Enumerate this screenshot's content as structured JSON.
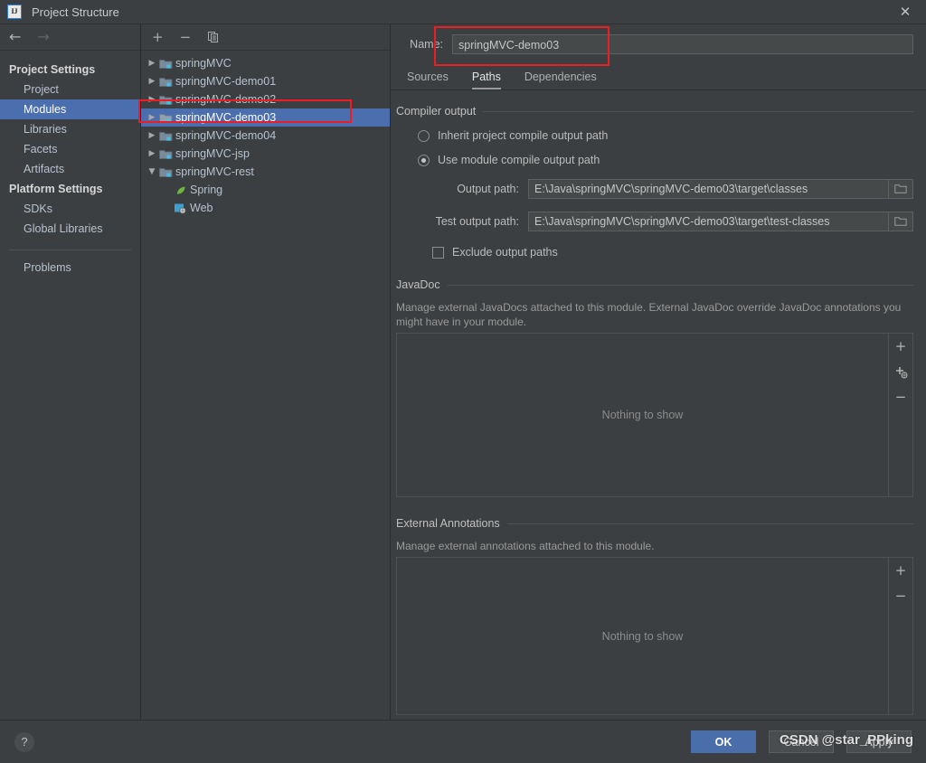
{
  "window": {
    "title": "Project Structure",
    "logo_text": "IJ",
    "close_icon": "✕"
  },
  "nav": {
    "back_icon": "←",
    "forward_icon": "→"
  },
  "sidebar": {
    "groups": [
      {
        "label": "Project Settings",
        "items": [
          {
            "label": "Project",
            "selected": false
          },
          {
            "label": "Modules",
            "selected": true
          },
          {
            "label": "Libraries",
            "selected": false
          },
          {
            "label": "Facets",
            "selected": false
          },
          {
            "label": "Artifacts",
            "selected": false
          }
        ]
      },
      {
        "label": "Platform Settings",
        "items": [
          {
            "label": "SDKs",
            "selected": false
          },
          {
            "label": "Global Libraries",
            "selected": false
          }
        ]
      }
    ],
    "problems_label": "Problems"
  },
  "tree": {
    "toolbar": {
      "add_icon": "+",
      "remove_icon": "−",
      "copy_icon": "copy-icon"
    },
    "expand_collapsed_icon": "▶",
    "expand_expanded_icon": "▼",
    "rows": [
      {
        "label": "springMVC",
        "icon": "module-folder-icon",
        "expanded": false,
        "selected": false,
        "child": false
      },
      {
        "label": "springMVC-demo01",
        "icon": "module-folder-icon",
        "expanded": false,
        "selected": false,
        "child": false
      },
      {
        "label": "springMVC-demo02",
        "icon": "module-folder-icon",
        "expanded": false,
        "selected": false,
        "child": false
      },
      {
        "label": "springMVC-demo03",
        "icon": "module-folder-icon",
        "expanded": false,
        "selected": true,
        "child": false
      },
      {
        "label": "springMVC-demo04",
        "icon": "module-folder-icon",
        "expanded": false,
        "selected": false,
        "child": false
      },
      {
        "label": "springMVC-jsp",
        "icon": "module-folder-icon",
        "expanded": false,
        "selected": false,
        "child": false
      },
      {
        "label": "springMVC-rest",
        "icon": "module-folder-icon",
        "expanded": true,
        "selected": false,
        "child": false
      },
      {
        "label": "Spring",
        "icon": "spring-leaf-icon",
        "expanded": null,
        "selected": false,
        "child": true
      },
      {
        "label": "Web",
        "icon": "web-facet-icon",
        "expanded": null,
        "selected": false,
        "child": true
      }
    ]
  },
  "module": {
    "name_label": "Name:",
    "name_value": "springMVC-demo03",
    "tabs": [
      {
        "label": "Sources",
        "active": false
      },
      {
        "label": "Paths",
        "active": true
      },
      {
        "label": "Dependencies",
        "active": false
      }
    ],
    "compiler_output": {
      "section_title": "Compiler output",
      "inherit_label": "Inherit project compile output path",
      "inherit_selected": false,
      "use_module_label": "Use module compile output path",
      "use_module_selected": true,
      "output_path_label": "Output path:",
      "output_path_value": "E:\\Java\\springMVC\\springMVC-demo03\\target\\classes",
      "test_output_path_label": "Test output path:",
      "test_output_path_value": "E:\\Java\\springMVC\\springMVC-demo03\\target\\test-classes",
      "exclude_label": "Exclude output paths",
      "exclude_checked": false,
      "browse_icon": "folder-browse-icon"
    },
    "javadoc": {
      "section_title": "JavaDoc",
      "description": "Manage external JavaDocs attached to this module. External JavaDoc override JavaDoc annotations you might have in your module.",
      "empty_text": "Nothing to show",
      "buttons": [
        {
          "icon": "+",
          "name": "add-javadoc-path-button"
        },
        {
          "icon": "+",
          "name": "add-javadoc-url-button"
        },
        {
          "icon": "−",
          "name": "remove-javadoc-button"
        }
      ]
    },
    "external_annotations": {
      "section_title": "External Annotations",
      "description": "Manage external annotations attached to this module.",
      "empty_text": "Nothing to show",
      "buttons": [
        {
          "icon": "+",
          "name": "add-annotations-button"
        },
        {
          "icon": "−",
          "name": "remove-annotations-button"
        }
      ]
    }
  },
  "footer": {
    "help_icon": "?",
    "ok_label": "OK",
    "cancel_label": "Cancel",
    "apply_label": "Apply"
  },
  "watermark": {
    "text": "CSDN @star_PPking"
  },
  "colors": {
    "background": "#3c3f41",
    "selection": "#4b6eaf",
    "primary_button": "#4a6ea9",
    "annotation": "#ee1d24",
    "field_background": "#45494a",
    "text": "#bbbbbb"
  }
}
